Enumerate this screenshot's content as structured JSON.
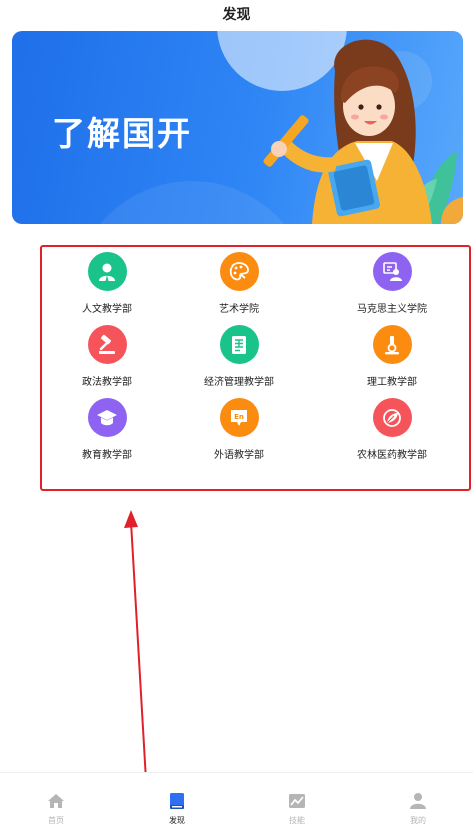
{
  "header": {
    "title": "发现"
  },
  "banner": {
    "slogan": "了解国开"
  },
  "departments": [
    {
      "label": "人文教学部",
      "icon": "person-icon",
      "color": "#19c38a"
    },
    {
      "label": "艺术学院",
      "icon": "palette-icon",
      "color": "#fb8c10"
    },
    {
      "label": "马克思主义学院",
      "icon": "lecturer-icon",
      "color": "#8f63f2"
    },
    {
      "label": "政法教学部",
      "icon": "gavel-icon",
      "color": "#f5555a"
    },
    {
      "label": "经济管理教学部",
      "icon": "ledger-icon",
      "color": "#19c38a"
    },
    {
      "label": "理工教学部",
      "icon": "microscope-icon",
      "color": "#fb8c10"
    },
    {
      "label": "教育教学部",
      "icon": "graduation-cap-icon",
      "color": "#8f63f2"
    },
    {
      "label": "外语教学部",
      "icon": "speech-bubble-icon",
      "color": "#fb8c10"
    },
    {
      "label": "农林医药教学部",
      "icon": "leaf-icon",
      "color": "#f5555a"
    }
  ],
  "tabbar": {
    "items": [
      {
        "label": "首页",
        "icon": "home-icon",
        "active": false
      },
      {
        "label": "发现",
        "icon": "book-icon",
        "active": true
      },
      {
        "label": "技能",
        "icon": "chart-icon",
        "active": false
      },
      {
        "label": "我的",
        "icon": "user-icon",
        "active": false
      }
    ]
  },
  "colors": {
    "accent": "#2f6ff0",
    "annotation": "#e0202a",
    "inactive": "#b5b5b5"
  }
}
